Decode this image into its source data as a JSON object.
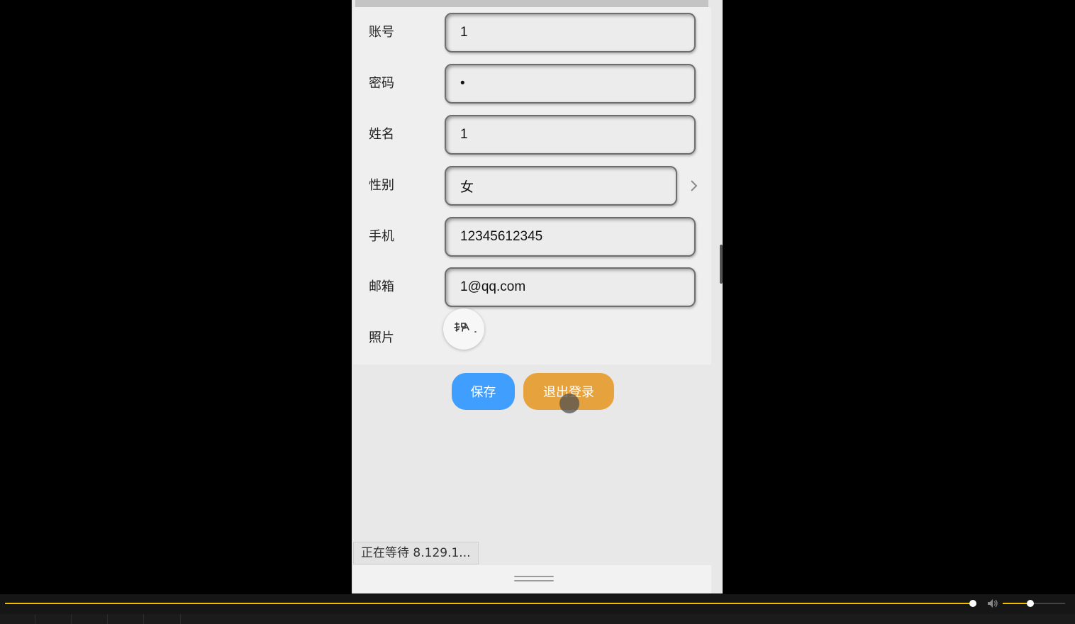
{
  "form": {
    "account": {
      "label": "账号",
      "value": "1"
    },
    "password": {
      "label": "密码",
      "value": "1"
    },
    "name": {
      "label": "姓名",
      "value": "1"
    },
    "gender": {
      "label": "性别",
      "value": "女"
    },
    "phone": {
      "label": "手机",
      "value": "12345612345"
    },
    "email": {
      "label": "邮箱",
      "value": "1@qq.com"
    },
    "photo": {
      "label": "照片"
    }
  },
  "buttons": {
    "save": "保存",
    "logout": "退出登录"
  },
  "status_bar": {
    "text": "正在等待 8.129.1..."
  },
  "player": {
    "progress": 0.9,
    "volume": 0.45
  },
  "colors": {
    "save": "#409eff",
    "logout": "#e6a23c",
    "seek": "#f0c000"
  },
  "icons": {
    "gender_picker": "chevron-right-icon",
    "volume": "speaker-icon"
  }
}
